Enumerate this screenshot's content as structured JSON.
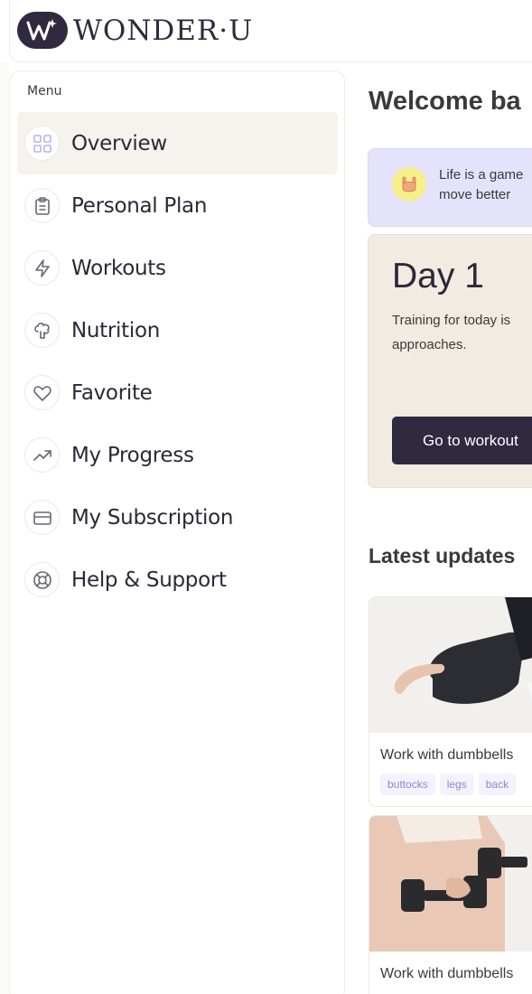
{
  "brand": {
    "name": "WONDER·U",
    "logo_color": "#2f2a40"
  },
  "sidebar": {
    "menu_label": "Menu",
    "items": [
      {
        "label": "Overview",
        "icon": "grid-icon",
        "active": true
      },
      {
        "label": "Personal Plan",
        "icon": "clipboard-icon",
        "active": false
      },
      {
        "label": "Workouts",
        "icon": "lightning-icon",
        "active": false
      },
      {
        "label": "Nutrition",
        "icon": "broccoli-icon",
        "active": false
      },
      {
        "label": "Favorite",
        "icon": "heart-icon",
        "active": false
      },
      {
        "label": "My Progress",
        "icon": "trending-up-icon",
        "active": false
      },
      {
        "label": "My Subscription",
        "icon": "credit-card-icon",
        "active": false
      },
      {
        "label": "Help & Support",
        "icon": "lifebuoy-icon",
        "active": false
      }
    ]
  },
  "main": {
    "welcome": "Welcome ba",
    "motivation": {
      "line1": "Life is a game",
      "line2": "move better",
      "icon": "rock-hand-icon"
    },
    "day_card": {
      "title": "Day 1",
      "desc_line1": "Training for today is",
      "desc_line2": "approaches.",
      "button_label": "Go to workout"
    },
    "latest_title": "Latest updates",
    "cards": [
      {
        "title": "Work with dumbbells",
        "tags": [
          "buttocks",
          "legs",
          "back"
        ]
      },
      {
        "title": "Work with dumbbells",
        "tags": []
      }
    ]
  },
  "colors": {
    "accent_dark": "#2f2a40",
    "active_bg": "#f6f3ee",
    "motivation_bg": "#e4e3fb",
    "daycard_bg": "#f1ebe1",
    "tag_text": "#8d86d8"
  }
}
